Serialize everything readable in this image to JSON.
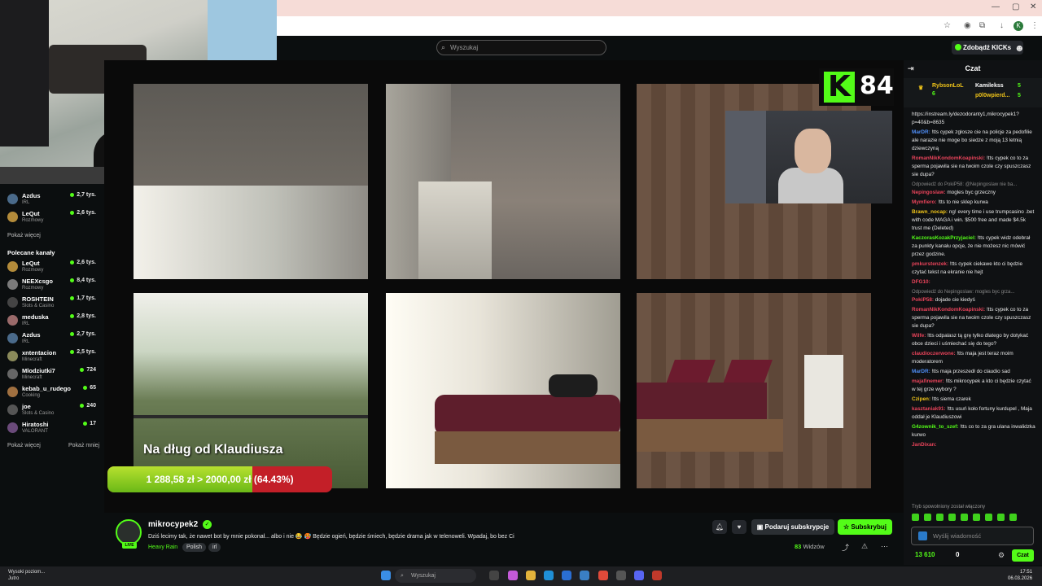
{
  "browser": {
    "title_bar": "",
    "kicks_button": "Zdobądź KICKs",
    "profile_letter": "K"
  },
  "header": {
    "search_placeholder": "Wyszukaj"
  },
  "sidebar": {
    "top_channels": [
      {
        "name": "Azdus",
        "category": "IRL",
        "viewers": "2,7 tys.",
        "color": "#4a6a8a"
      },
      {
        "name": "LeQut",
        "category": "Rozmowy",
        "viewers": "2,6 tys.",
        "color": "#b38b3a"
      }
    ],
    "show_more_1": "Pokaż więcej",
    "recommended_heading": "Polecane kanały",
    "recommended": [
      {
        "name": "LeQut",
        "category": "Rozmowy",
        "viewers": "2,6 tys.",
        "color": "#b38b3a"
      },
      {
        "name": "NEEXcsgo",
        "category": "Rozmowy",
        "viewers": "8,4 tys.",
        "color": "#7a7a7a"
      },
      {
        "name": "ROSHTEIN",
        "category": "Slots & Casino",
        "viewers": "1,7 tys.",
        "color": "#444"
      },
      {
        "name": "meduska",
        "category": "IRL",
        "viewers": "2,8 tys.",
        "color": "#9a6a6a"
      },
      {
        "name": "Azdus",
        "category": "IRL",
        "viewers": "2,7 tys.",
        "color": "#4a6a8a"
      },
      {
        "name": "xntentacion",
        "category": "Minecraft",
        "viewers": "2,5 tys.",
        "color": "#8a8a5a"
      },
      {
        "name": "Mlodziutki7",
        "category": "Minecraft",
        "viewers": "724",
        "color": "#666"
      },
      {
        "name": "kebab_u_rudego",
        "category": "Cooking",
        "viewers": "65",
        "color": "#a07040"
      },
      {
        "name": "joe",
        "category": "Slots & Casino",
        "viewers": "240",
        "color": "#555"
      },
      {
        "name": "Hiratoshi",
        "category": "VALORANT",
        "viewers": "17",
        "color": "#6a4a7a"
      }
    ],
    "show_more_2": "Pokaż więcej",
    "show_less": "Pokaż mniej"
  },
  "player": {
    "overlay_k": "K",
    "overlay_number": "84",
    "goal_title": "Na dług od Klaudiusza",
    "goal_text": "1 288,58 zł > 2000,00 zł (64.43%)",
    "goal_fraction": 0.6443
  },
  "stream": {
    "name": "mikrocypek2",
    "title": "Dziś lecimy tak, że nawet bot by mnie pokonał... albo i nie 😂 🥵 Będzie ogień, będzie śmiech, będzie drama jak w telenoweli. Wpadaj, bo bez Ci",
    "category": "Heavy Rain",
    "tags": [
      "Polish",
      "irl"
    ],
    "subscribe_label": "Podaruj subskrypcje",
    "follow_label": "Subskrybuj",
    "viewers_count": "83",
    "viewers_label": "Widzów",
    "live_badge": "LIVE"
  },
  "chat": {
    "title": "Czat",
    "leaderboard": [
      {
        "name": "RybsonLoL",
        "count": "6"
      },
      {
        "name": "Kamilekss",
        "count": "5"
      },
      {
        "name": "p0l0wpierd...",
        "count": "5"
      }
    ],
    "messages": [
      {
        "user": "",
        "color": "#fff",
        "text": "https://instream.ly/dezodoranty1,mikrocypek1?p=40&b=8635",
        "reply": ""
      },
      {
        "user": "MarDR:",
        "color": "#4f8ef7",
        "text": "!tts cypek zgłosze cie na policje za pedofilie ale narazie nie moge bo siedze z moją 13 letnią dziewczyną",
        "reply": ""
      },
      {
        "user": "RomanNikKondomKoapinski:",
        "color": "#e8435a",
        "text": "!tts cypek co to za sperma pojawila sie na twoim czole czy spuszczasz sie dupa?",
        "reply": ""
      },
      {
        "user": "Nepingoslaw:",
        "color": "#e8435a",
        "text": "mogles byc grzeczny",
        "reply": "Odpowiedź do PokiP58: @Nepingoslaw nie ba..."
      },
      {
        "user": "Mymfiero:",
        "color": "#e8435a",
        "text": "!tts to nie sklep kurwa",
        "reply": ""
      },
      {
        "user": "Brawn_nocap:",
        "color": "#f0c419",
        "text": "ng! every time i use trumpcasino .bet with code MAGA i win. $500 free and made $4.5k trust me (Deleted)",
        "reply": ""
      },
      {
        "user": "KaczorasKozakPrzyjaciel:",
        "color": "#53fc18",
        "text": "!tts cypek widz odebrał za punkty kanału opcje, że nie możesz nic mówić przez godzine.",
        "reply": ""
      },
      {
        "user": "pmkurstenzek:",
        "color": "#e8435a",
        "text": "!tts cypek ciekawe kto ci będzie czytać tekst na ekranie nie hejt",
        "reply": ""
      },
      {
        "user": "DFG10:",
        "color": "#e8435a",
        "text": "",
        "reply": ""
      },
      {
        "user": "PokiP58:",
        "color": "#e8435a",
        "text": "dojade cie kiedyś",
        "reply": "Odpowiedź do Nepingoslaw: mogles byc grza..."
      },
      {
        "user": "RomanNikKondomKoapinski:",
        "color": "#e8435a",
        "text": "!tts cypek co to za sperma pojawila sie na twoim czole czy spuszczasz sie dupa?",
        "reply": ""
      },
      {
        "user": "Wilfe:",
        "color": "#e8435a",
        "text": "!tts odpalasz tą grę tylko dlatego by dotykać obce dzieci i uśmiechać się do tego?",
        "reply": ""
      },
      {
        "user": "claudioczerwone:",
        "color": "#e8435a",
        "text": "!tts maja jest teraz moim moderatorem",
        "reply": ""
      },
      {
        "user": "MarDR:",
        "color": "#4f8ef7",
        "text": "!tts maja przeszedł do claudio sad",
        "reply": ""
      },
      {
        "user": "majafinemer:",
        "color": "#e8435a",
        "text": "!tts mikrocypek a kto ci będzie czytać w tej grze wybory ?",
        "reply": ""
      },
      {
        "user": "Czipen:",
        "color": "#f0c419",
        "text": "!tts siema czarek",
        "reply": ""
      },
      {
        "user": "kasztaniak91:",
        "color": "#e8435a",
        "text": "!tts usuń koło fortuny kurdupel , Maja oddał je Klaudiuszowi",
        "reply": ""
      },
      {
        "user": "G4zownik_to_szef:",
        "color": "#53fc18",
        "text": "!tts co to za gra ulana inwalidzka kurwo",
        "reply": ""
      },
      {
        "user": "JanDixan:",
        "color": "#e8435a",
        "text": "",
        "reply": ""
      }
    ],
    "slow_mode": "Tryb spowolniony został włączony",
    "input_placeholder": "Wyślij wiadomość",
    "kicks_points": "13 610",
    "zero_points": "0",
    "chat_button": "Czat"
  },
  "taskbar": {
    "weather_line1": "Wysoki poziom...",
    "weather_line2": "Jutro",
    "search_placeholder": "Wyszukaj",
    "time": "17:51",
    "date": "06.03.2026"
  }
}
